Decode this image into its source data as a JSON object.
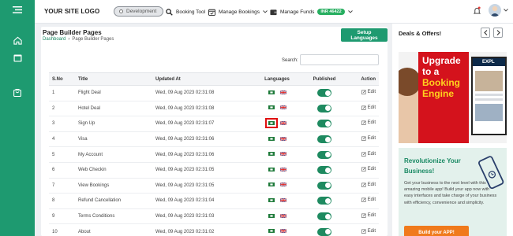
{
  "app": {
    "logo": "YOUR SITE LOGO",
    "environment_badge": "Development"
  },
  "topnav": {
    "booking_tool": "Booking Tool",
    "manage_bookings": "Manage Bookings",
    "manage_funds": "Manage Funds",
    "funds_amount": "INR 46422"
  },
  "page": {
    "title": "Page Builder Pages",
    "breadcrumb": [
      "Dashboard",
      "Page Builder Pages"
    ],
    "setup_button": "Setup Languages",
    "search_label": "Search:",
    "search_value": ""
  },
  "table": {
    "columns": [
      "S.No",
      "Title",
      "Updated At",
      "Languages",
      "Published",
      "Action"
    ],
    "rows": [
      {
        "no": "1",
        "title": "Flight Deal",
        "updated": "Wed, 09 Aug 2023 02:31:08",
        "action": "Edit"
      },
      {
        "no": "2",
        "title": "Hotel Deal",
        "updated": "Wed, 09 Aug 2023 02:31:08",
        "action": "Edit"
      },
      {
        "no": "3",
        "title": "Sign Up",
        "updated": "Wed, 09 Aug 2023 02:31:07",
        "action": "Edit"
      },
      {
        "no": "4",
        "title": "Visa",
        "updated": "Wed, 09 Aug 2023 02:31:06",
        "action": "Edit"
      },
      {
        "no": "5",
        "title": "My Account",
        "updated": "Wed, 09 Aug 2023 02:31:06",
        "action": "Edit"
      },
      {
        "no": "6",
        "title": "Web Checkin",
        "updated": "Wed, 09 Aug 2023 02:31:05",
        "action": "Edit"
      },
      {
        "no": "7",
        "title": "View Bookings",
        "updated": "Wed, 09 Aug 2023 02:31:05",
        "action": "Edit"
      },
      {
        "no": "8",
        "title": "Refund Cancellation",
        "updated": "Wed, 09 Aug 2023 02:31:04",
        "action": "Edit"
      },
      {
        "no": "9",
        "title": "Terms Conditions",
        "updated": "Wed, 09 Aug 2023 02:31:03",
        "action": "Edit"
      },
      {
        "no": "10",
        "title": "About",
        "updated": "Wed, 09 Aug 2023 02:31:02",
        "action": "Edit"
      }
    ]
  },
  "side": {
    "deals_title": "Deals & Offers!",
    "banner_lines": [
      "Upgrade",
      "to a",
      "Booking",
      "Engine"
    ],
    "banner_screen_label": "EXPL",
    "promo_title_1": "Revolutionize Your",
    "promo_title_2": "Business!",
    "promo_text": "Get your business to the next level with this amazing mobile app! Build your app now with easy interfaces and take charge of your business with efficiency, convenience and simplicity.",
    "promo_button": "Build your APP!"
  },
  "colors": {
    "brand_green": "#1e9a70",
    "toggle_on": "#1e8a60",
    "promo_orange": "#f07a1c",
    "highlight_red": "#e01010"
  }
}
